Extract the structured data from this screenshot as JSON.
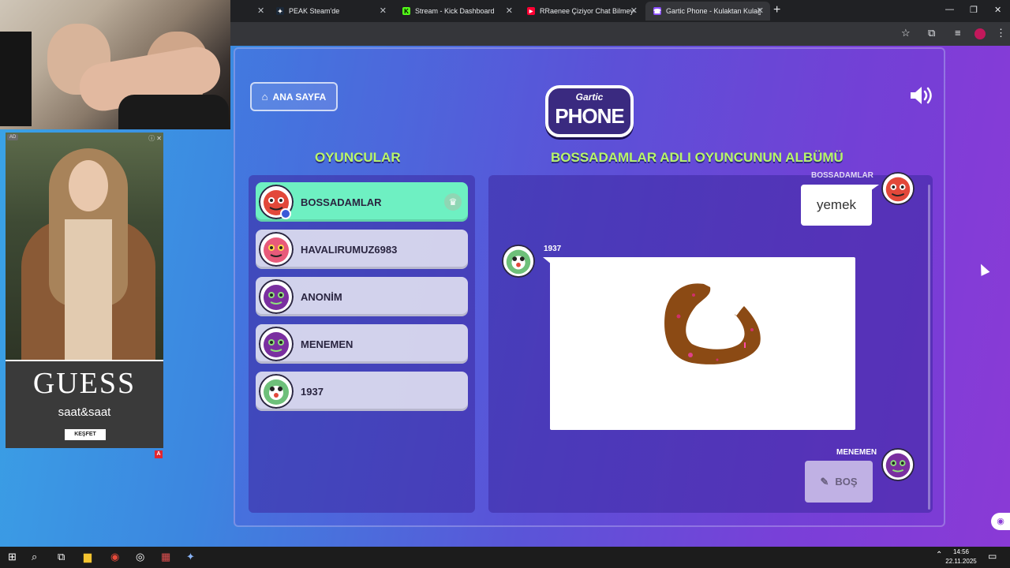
{
  "browser": {
    "tabs": [
      {
        "title": "PEAK Steam'de",
        "favicon": "steam-icon",
        "color": "#1b2838"
      },
      {
        "title": "Stream - Kick Dashboard",
        "favicon": "kick-icon",
        "color": "#53fc18"
      },
      {
        "title": "RRaenee Çiziyor Chat Bilmeye Ç",
        "favicon": "youtube-icon",
        "color": "#ff0033"
      },
      {
        "title": "Gartic Phone - Kulaktan Kulağa",
        "favicon": "gartic-icon",
        "color": "#8a4dff"
      }
    ],
    "new_tab": "+",
    "window_controls": [
      "—",
      "❐",
      "✕"
    ]
  },
  "ad": {
    "label": "AD",
    "brand": "GUESS",
    "subtitle": "saat&saat",
    "cta": "KEŞFET",
    "badge": "A"
  },
  "game": {
    "home_button": "ANA SAYFA",
    "logo_top": "Gartic",
    "logo_main": "PHONE",
    "players_title": "OYUNCULAR",
    "album_title": "BOSSADAMLAR ADLI OYUNCUNUN ALBÜMÜ",
    "players": [
      {
        "name": "BOSSADAMLAR",
        "host": true,
        "avatar_color": "#e2483a"
      },
      {
        "name": "HAVALIRUMUZ6983",
        "host": false,
        "avatar_color": "#e85a7a"
      },
      {
        "name": "ANONİM",
        "host": false,
        "avatar_color": "#7a2fa0"
      },
      {
        "name": "MENEMEN",
        "host": false,
        "avatar_color": "#7a2fa0"
      },
      {
        "name": "1937",
        "host": false,
        "avatar_color": "#6ec07a"
      }
    ],
    "album": {
      "top_author": "BOSSADAMLAR",
      "first_phrase": "yemek",
      "drawing_author": "1937",
      "last_author": "MENEMEN",
      "empty_label": "BOŞ"
    }
  },
  "taskbar": {
    "time": "14:56",
    "date": "22.11.2025"
  }
}
